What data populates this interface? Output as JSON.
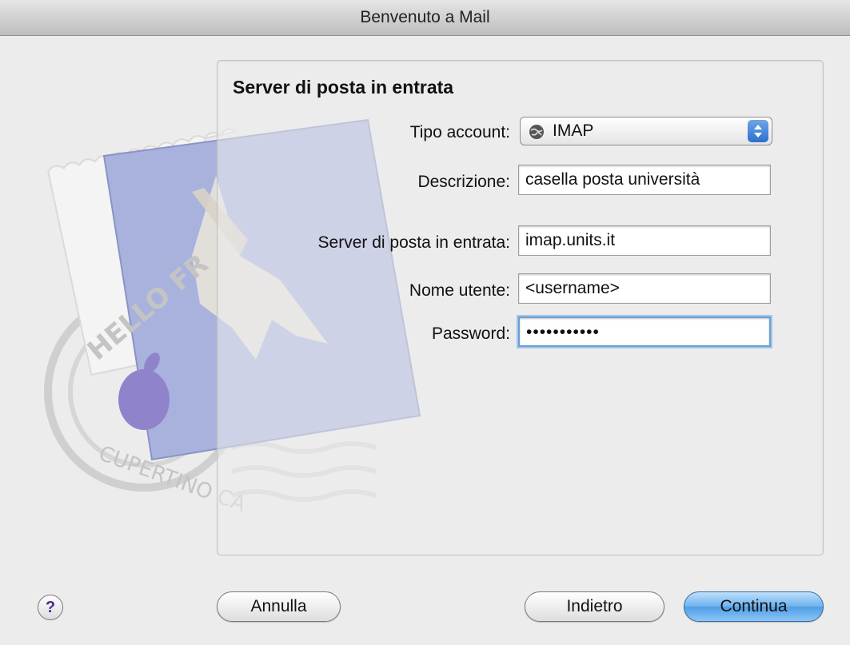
{
  "window": {
    "title": "Benvenuto a Mail"
  },
  "panel": {
    "title": "Server di posta in entrata",
    "fields": {
      "tipo_account": {
        "label": "Tipo account:",
        "value": "IMAP"
      },
      "descrizione": {
        "label": "Descrizione:",
        "value": "casella posta università"
      },
      "server": {
        "label": "Server di posta in entrata:",
        "value": "imap.units.it"
      },
      "nome_utente": {
        "label": "Nome utente:",
        "value": "<username>"
      },
      "password": {
        "label": "Password:",
        "value": "•••••••••••"
      }
    }
  },
  "stamp": {
    "text_top": "HELLO FR",
    "text_bottom": "CUPERTINO CA"
  },
  "buttons": {
    "help": "?",
    "cancel": "Annulla",
    "back": "Indietro",
    "continue": "Continua"
  },
  "colors": {
    "accent": "#4f9ee6",
    "focus_ring": "#6a9fd6"
  }
}
